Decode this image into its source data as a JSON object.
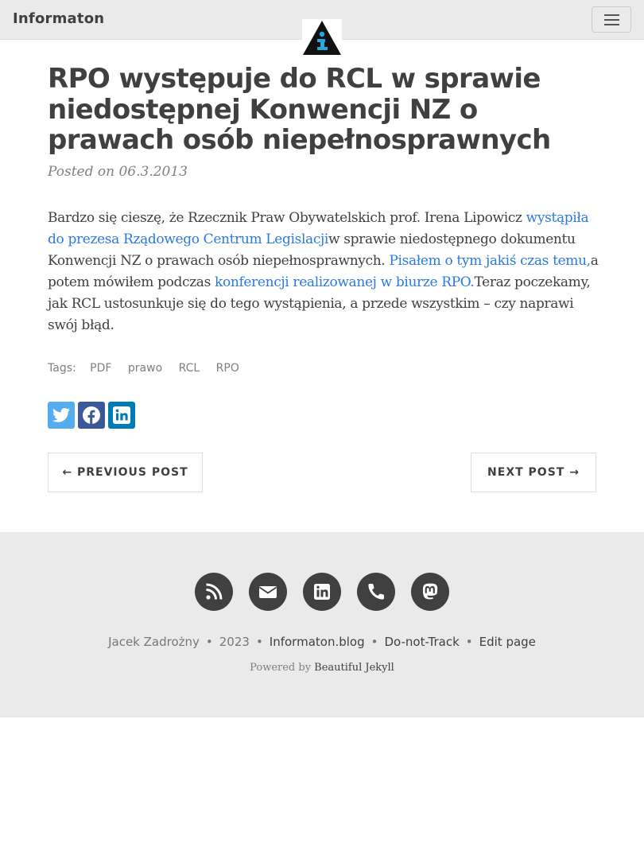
{
  "navbar": {
    "brand": "Informaton",
    "logo_icon": "info-triangle-logo",
    "menu_icon": "hamburger-icon"
  },
  "post": {
    "title": "RPO występuje do RCL w sprawie niedostępnej Konwencji NZ o prawach osób niepełnosprawnych",
    "meta_prefix": "Posted on ",
    "date": "06.3.2013",
    "body": {
      "t1": "Bardzo się cieszę, że Rzecznik Praw Obywatelskich prof. Irena Lipowicz ",
      "link1": "wystąpiła do prezesa Rządowego Centrum Legislacji",
      "t2": "w sprawie niedostępnego dokumentu Konwencji NZ o prawach osób niepełnosprawnych. ",
      "link2": "Pisałem o tym jakiś czas temu,",
      "t3": "a potem mówiłem podczas ",
      "link3": "konferencji realizowanej w biurze RPO.",
      "t4": "Teraz poczekamy, jak RCL ustosunkuje się do tego wystąpienia, a przede wszystkim – czy naprawi swój błąd."
    },
    "tags_label": "Tags:",
    "tags": [
      "PDF",
      "prawo",
      "RCL",
      "RPO"
    ]
  },
  "share": [
    {
      "icon": "twitter-icon",
      "color": "#55acee"
    },
    {
      "icon": "facebook-icon",
      "color": "#3b5998"
    },
    {
      "icon": "linkedin-icon",
      "color": "#007bb5"
    }
  ],
  "pager": {
    "previous": "← PREVIOUS POST",
    "next": "NEXT POST →"
  },
  "footer": {
    "social_icons": [
      "rss-icon",
      "envelope-icon",
      "linkedin-icon",
      "phone-icon",
      "mastodon-icon"
    ],
    "author": "Jacek Zadrożny",
    "year": "2023",
    "site": "Informaton.blog",
    "dnt": "Do-not-Track",
    "edit": "Edit page",
    "powered_prefix": "Powered by ",
    "powered_link": "Beautiful Jekyll"
  },
  "colors": {
    "link": "#2a7ae2",
    "text": "#404040",
    "footer_bg": "#eaeaea"
  }
}
